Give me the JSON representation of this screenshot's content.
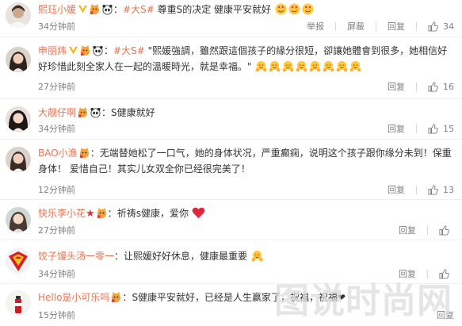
{
  "colors": {
    "username": "#eb7350",
    "topic": "#eb7350",
    "meta": "#808080"
  },
  "labels": {
    "report": "举报",
    "hide": "屏蔽",
    "reply": "回复"
  },
  "comments": [
    {
      "user": "熙珏小媛",
      "topic": "#大S#",
      "text": " 尊重S的决定  健康平安就好",
      "time": "34分钟前",
      "likes": "34",
      "badges": [
        "v-icon",
        "cat-badge-icon",
        "panda-badge-icon"
      ],
      "trailing_emoji": "heart-eyes-emoji x3",
      "actions": [
        "report",
        "hide",
        "reply"
      ]
    },
    {
      "user": "申丽炜",
      "topic": "#大S#",
      "text": " \"熙媛強調，雖然跟這個孩子的緣分很短，卻讓她體會到很多，她相信好好珍惜此刻全家人在一起的溫暖時光，就是幸福。\"",
      "time": "27分钟前",
      "likes": "16",
      "badges": [
        "v-icon",
        "cat-badge-icon",
        "panda-badge-icon"
      ],
      "trailing_emoji": "hug-emoji x8",
      "actions": [
        "reply"
      ]
    },
    {
      "user": "大靓仔啊",
      "topic": "",
      "text": "S健康就好",
      "time": "34分钟前",
      "likes": "15",
      "badges": [
        "cat-badge-icon",
        "panda-badge-icon"
      ],
      "actions": [
        "reply"
      ]
    },
    {
      "user": "BAO小渔",
      "topic": "",
      "text": "无端替她松了一口气，她的身体状况，严重癫痫，说明这个孩子跟你缘分未到！保重身体！ 爱惜自己！其实儿女双全你已经很完美了！",
      "time": "12分钟前",
      "likes": "13",
      "badges": [
        "cat-badge-icon"
      ],
      "actions": [
        "reply"
      ]
    },
    {
      "user": "快乐李小花",
      "topic": "",
      "text": "祈祷s健康，爱你",
      "time": "27分钟前",
      "likes": "",
      "badges": [
        "star-icon",
        "cat-badge-icon"
      ],
      "trailing_emoji": "heart-emoji",
      "actions": [
        "reply"
      ]
    },
    {
      "user": "饺子馒头汤一零一",
      "topic": "",
      "text": "让熙媛好好休息，健康最重要",
      "time": "34分钟前",
      "likes": "",
      "badges": [],
      "trailing_emoji": "hug-emoji",
      "actions": [
        "reply"
      ]
    },
    {
      "user": "Hello是小可乐吗",
      "topic": "",
      "text": "S健康平安就好，已经是人生赢家了，祝福，祝福❤",
      "time": "15分钟前",
      "likes": "",
      "badges": [
        "cat-badge-icon"
      ],
      "actions": [
        "reply"
      ]
    }
  ],
  "watermark": "图说时尚网"
}
